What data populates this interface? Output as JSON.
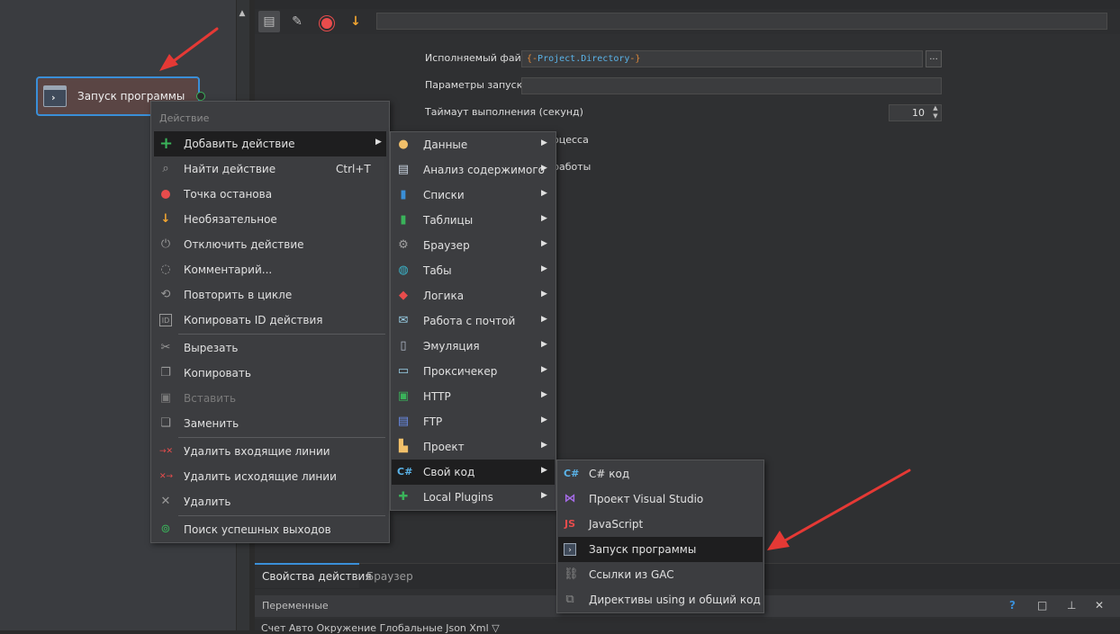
{
  "canvas": {
    "node_label": "Запуск программы"
  },
  "toolbar": {
    "field_value": ""
  },
  "properties": {
    "exe_label": "Исполняемый файл",
    "exe_value_open": "{-",
    "exe_value_body": "Project.Directory",
    "exe_value_close": "-}",
    "exe_browse": "...",
    "params_label": "Параметры запуска",
    "timeout_label": "Таймаут выполнения (секунд)",
    "timeout_value": "10",
    "partial_label_1": "оцесса",
    "partial_label_2": "работы"
  },
  "bottom": {
    "tab_properties": "Свойства действия",
    "tab_browser": "Браузер",
    "vars_title": "Переменные",
    "vars_help": "?",
    "vars_sub": "Счет   Авто   Окружение   Глобальные   Json   Xml   ▽"
  },
  "menu1": {
    "header": "Действие",
    "items": [
      {
        "label": "Добавить действие",
        "icon": "plus-icon",
        "arrow": "▶"
      },
      {
        "label": "Найти действие",
        "icon": "search-icon",
        "shortcut": "Ctrl+T"
      },
      {
        "label": "Точка останова",
        "icon": "breakpoint-icon"
      },
      {
        "label": "Необязательное",
        "icon": "optional-arrow-icon"
      },
      {
        "label": "Отключить действие",
        "icon": "power-icon"
      },
      {
        "label": "Комментарий...",
        "icon": "comment-icon"
      },
      {
        "label": "Повторить в цикле",
        "icon": "loop-icon"
      },
      {
        "label": "Копировать ID действия",
        "icon": "id-icon"
      },
      {
        "label": "Вырезать",
        "icon": "scissors-icon"
      },
      {
        "label": "Копировать",
        "icon": "copy-icon"
      },
      {
        "label": "Вставить",
        "icon": "paste-icon"
      },
      {
        "label": "Заменить",
        "icon": "replace-icon"
      },
      {
        "label": "Удалить входящие линии",
        "icon": "remove-incoming-icon"
      },
      {
        "label": "Удалить исходящие линии",
        "icon": "remove-outgoing-icon"
      },
      {
        "label": "Удалить",
        "icon": "delete-icon"
      },
      {
        "label": "Поиск успешных выходов",
        "icon": "find-success-icon"
      }
    ]
  },
  "menu2": {
    "items": [
      {
        "label": "Данные",
        "icon": "user-data-icon"
      },
      {
        "label": "Анализ содержимого",
        "icon": "content-analysis-icon"
      },
      {
        "label": "Списки",
        "icon": "lists-icon"
      },
      {
        "label": "Таблицы",
        "icon": "tables-icon"
      },
      {
        "label": "Браузер",
        "icon": "browser-gear-icon"
      },
      {
        "label": "Табы",
        "icon": "tabs-globe-icon"
      },
      {
        "label": "Логика",
        "icon": "logic-icon"
      },
      {
        "label": "Работа с почтой",
        "icon": "mail-icon"
      },
      {
        "label": "Эмуляция",
        "icon": "mouse-icon"
      },
      {
        "label": "Проксичекер",
        "icon": "proxy-monitor-icon"
      },
      {
        "label": "HTTP",
        "icon": "http-icon"
      },
      {
        "label": "FTP",
        "icon": "ftp-icon"
      },
      {
        "label": "Проект",
        "icon": "project-icon"
      },
      {
        "label": "Свой код",
        "icon": "csharp-icon",
        "icon_text": "C#"
      },
      {
        "label": "Local Plugins",
        "icon": "plugin-icon"
      }
    ]
  },
  "menu3": {
    "items": [
      {
        "label": "C# код",
        "icon": "csharp-code-icon",
        "icon_text": "C#"
      },
      {
        "label": "Проект Visual Studio",
        "icon": "visual-studio-icon"
      },
      {
        "label": "JavaScript",
        "icon": "javascript-icon",
        "icon_text": "JS"
      },
      {
        "label": "Запуск программы",
        "icon": "run-program-icon"
      },
      {
        "label": "Ссылки из GAC",
        "icon": "link-icon"
      },
      {
        "label": "Директивы using и общий код",
        "icon": "directives-icon"
      }
    ]
  },
  "colors": {
    "accent": "#3a8fd8",
    "arrow": "#e53935",
    "menu_bg": "#3c3d40",
    "highlight": "#1e1e1f"
  }
}
